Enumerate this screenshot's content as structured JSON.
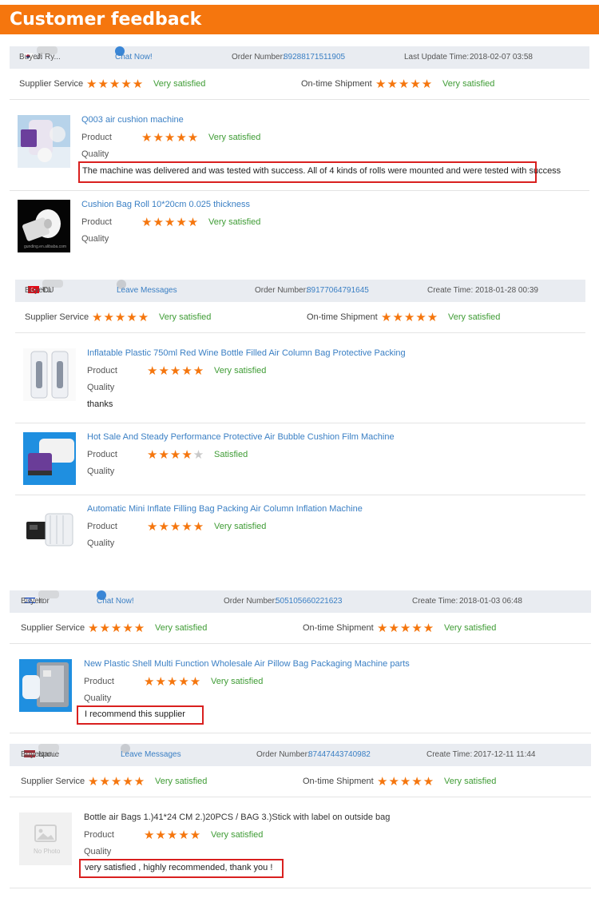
{
  "title": "Customer feedback",
  "labels": {
    "buyer": "Buyer:",
    "order_number": "Order Number:",
    "supplier_service": "Supplier Service",
    "ontime_shipment": "On-time Shipment",
    "product": "Product",
    "quality": "Quality"
  },
  "colors": {
    "accent": "#f5760e",
    "link": "#3a7fc4",
    "satisfied": "#3f9c35",
    "highlight": "#d9201f"
  },
  "feedback": [
    {
      "buyer_a": "J",
      "buyer_b": "Ji Ry...",
      "flag": "kr-flag-icon",
      "action": "Chat Now!",
      "order_number": "89288171511905",
      "time_label": "Last Update Time:",
      "time": "2018-02-07 03:58",
      "supplier_rating": 5,
      "supplier_text": "Very satisfied",
      "shipment_rating": 5,
      "shipment_text": "Very satisfied",
      "items": [
        {
          "title": "Q003 air cushion machine",
          "rating": 5,
          "rating_text": "Very satisfied",
          "comment": "The machine was delivered and was tested with success. All of 4 kinds of rolls were mounted and were tested with success"
        },
        {
          "title": "Cushion Bag Roll 10*20cm 0.025 thickness",
          "rating": 5,
          "rating_text": "Very satisfied",
          "comment": "",
          "thumb_caption": "gunding.en.alibaba.com"
        }
      ]
    },
    {
      "buyer_a": "Tu",
      "buyer_b": "CU",
      "flag": "tr-flag-icon",
      "action": "Leave Messages",
      "order_number": "89177064791645",
      "time_label": "Create Time:",
      "time": "2018-01-28 00:39",
      "supplier_rating": 5,
      "supplier_text": "Very satisfied",
      "shipment_rating": 5,
      "shipment_text": "Very satisfied",
      "items": [
        {
          "title": "Inflatable Plastic 750ml Red Wine Bottle Filled Air Column Bag Protective Packing",
          "rating": 5,
          "rating_text": "Very satisfied",
          "comment": "thanks"
        },
        {
          "title": "Hot Sale And Steady Performance Protective Air Bubble Cushion Film Machine",
          "rating": 4,
          "rating_text": "Satisfied",
          "comment": ""
        },
        {
          "title": "Automatic Mini Inflate Filling Bag Packing Air Column Inflation Machine",
          "rating": 5,
          "rating_text": "Very satisfied",
          "comment": ""
        }
      ]
    },
    {
      "buyer_a": "Ilor",
      "buyer_b": "",
      "flag": "il-flag-icon",
      "action": "Chat Now!",
      "order_number": "505105660221623",
      "time_label": "Create Time:",
      "time": "2018-01-03 06:48",
      "supplier_rating": 5,
      "supplier_text": "Very satisfied",
      "shipment_rating": 5,
      "shipment_text": "Very satisfied",
      "items": [
        {
          "title": "New Plastic Shell Multi Function Wholesale Air Pillow Bag Packaging Machine parts",
          "rating": 5,
          "rating_text": "Very satisfied",
          "comment": "I recommend this supplier"
        }
      ]
    },
    {
      "buyer_a": "Danie",
      "buyer_b": "apo...",
      "flag": "lv-flag-icon",
      "action": "Leave Messages",
      "order_number": "87447443740982",
      "time_label": "Create Time:",
      "time": "2017-12-11 11:44",
      "supplier_rating": 5,
      "supplier_text": "Very satisfied",
      "shipment_rating": 5,
      "shipment_text": "Very satisfied",
      "items": [
        {
          "title": "Bottle air Bags 1.)41*24 CM 2.)20PCS / BAG 3.)Stick with label on outside bag",
          "rating": 5,
          "rating_text": "Very satisfied",
          "comment": "very satisfied , highly recommended, thank you !",
          "thumb_caption": "No Photo"
        }
      ]
    }
  ]
}
